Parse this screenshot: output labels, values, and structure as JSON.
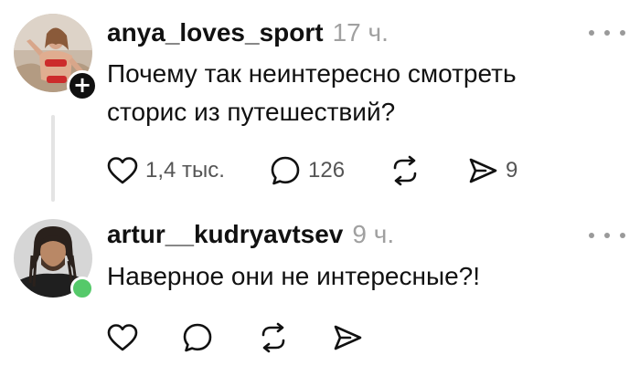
{
  "posts": [
    {
      "author": "anya_loves_sport",
      "time": "17 ч.",
      "text_line1": "Почему так неинтересно смотреть",
      "text_line2": "сторис из путешествий?",
      "likes": "1,4 тыс.",
      "comments": "126",
      "shares": "9",
      "avatar_icon": "avatar-photo",
      "badge_icon": "plus-icon",
      "badge": "+"
    },
    {
      "author": "artur__kudryavtsev",
      "time": "9 ч.",
      "text_line1": "Наверное они не интересные?!",
      "avatar_icon": "avatar-photo",
      "status_color": "#55c96a"
    }
  ],
  "icons": {
    "like": "heart-icon",
    "comment": "comment-bubble-icon",
    "repost": "repost-icon",
    "share": "send-icon",
    "more": "more-dots-icon"
  }
}
